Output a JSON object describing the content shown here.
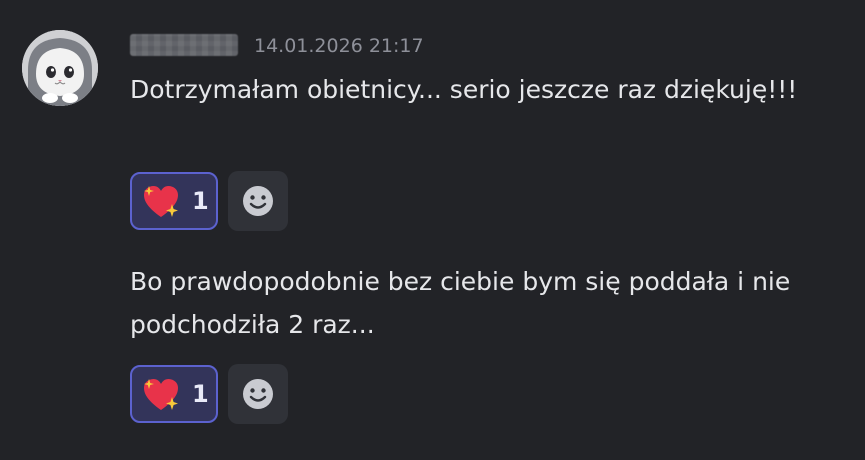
{
  "message": {
    "timestamp": "14.01.2026 21:17",
    "lines": [
      "Dotrzymałam obietnicy... serio jeszcze raz dziękuję!!!",
      "Bo prawdopodobnie bez ciebie bym się poddała i nie podchodziła 2 raz..."
    ]
  },
  "reactions": [
    {
      "emoji": "sparkling-heart-icon",
      "count": "1"
    },
    {
      "emoji": "sparkling-heart-icon",
      "count": "1"
    }
  ],
  "colors": {
    "background": "#222327",
    "reaction_border": "#5c62cf",
    "reaction_bg": "#33345a",
    "timestamp": "#8e9099",
    "heart": "#e8334a",
    "sparkle": "#f8c93a"
  }
}
